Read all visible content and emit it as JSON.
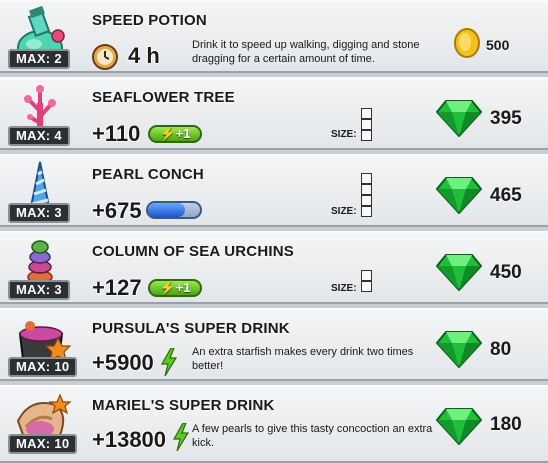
{
  "items": [
    {
      "title": "SPEED POTION",
      "max": "MAX: 2",
      "duration": "4 h",
      "description": "Drink it to speed up walking, digging and stone dragging for a certain amount of time.",
      "price": "500",
      "currency": "coin"
    },
    {
      "title": "SEAFLOWER TREE",
      "max": "MAX: 4",
      "bonus": "+110",
      "pill": "+1",
      "size_label": "SIZE:",
      "price": "395",
      "currency": "gem"
    },
    {
      "title": "PEARL CONCH",
      "max": "MAX: 3",
      "bonus": "+675",
      "size_label": "SIZE:",
      "price": "465",
      "currency": "gem"
    },
    {
      "title": "COLUMN OF SEA URCHINS",
      "max": "MAX: 3",
      "bonus": "+127",
      "pill": "+1",
      "size_label": "SIZE:",
      "price": "450",
      "currency": "gem"
    },
    {
      "title": "PURSULA'S SUPER DRINK",
      "max": "MAX: 10",
      "bonus": "+5900",
      "description": "An extra starfish makes every drink two times better!",
      "price": "80",
      "currency": "gem"
    },
    {
      "title": "MARIEL'S SUPER DRINK",
      "max": "MAX: 10",
      "bonus": "+13800",
      "description": "A few pearls to give this tasty concoction an extra kick.",
      "price": "180",
      "currency": "gem"
    }
  ],
  "colors": {
    "gem": "#1fbf3a",
    "coin": "#f3c21a",
    "energy": "#5cc924"
  },
  "icons": [
    "clock-icon",
    "coin-icon",
    "gem-icon",
    "lightning-icon",
    "potion-icon",
    "seaflower-tree-icon",
    "pearl-conch-icon",
    "sea-urchins-icon",
    "pursula-drink-icon",
    "mariel-drink-icon"
  ]
}
